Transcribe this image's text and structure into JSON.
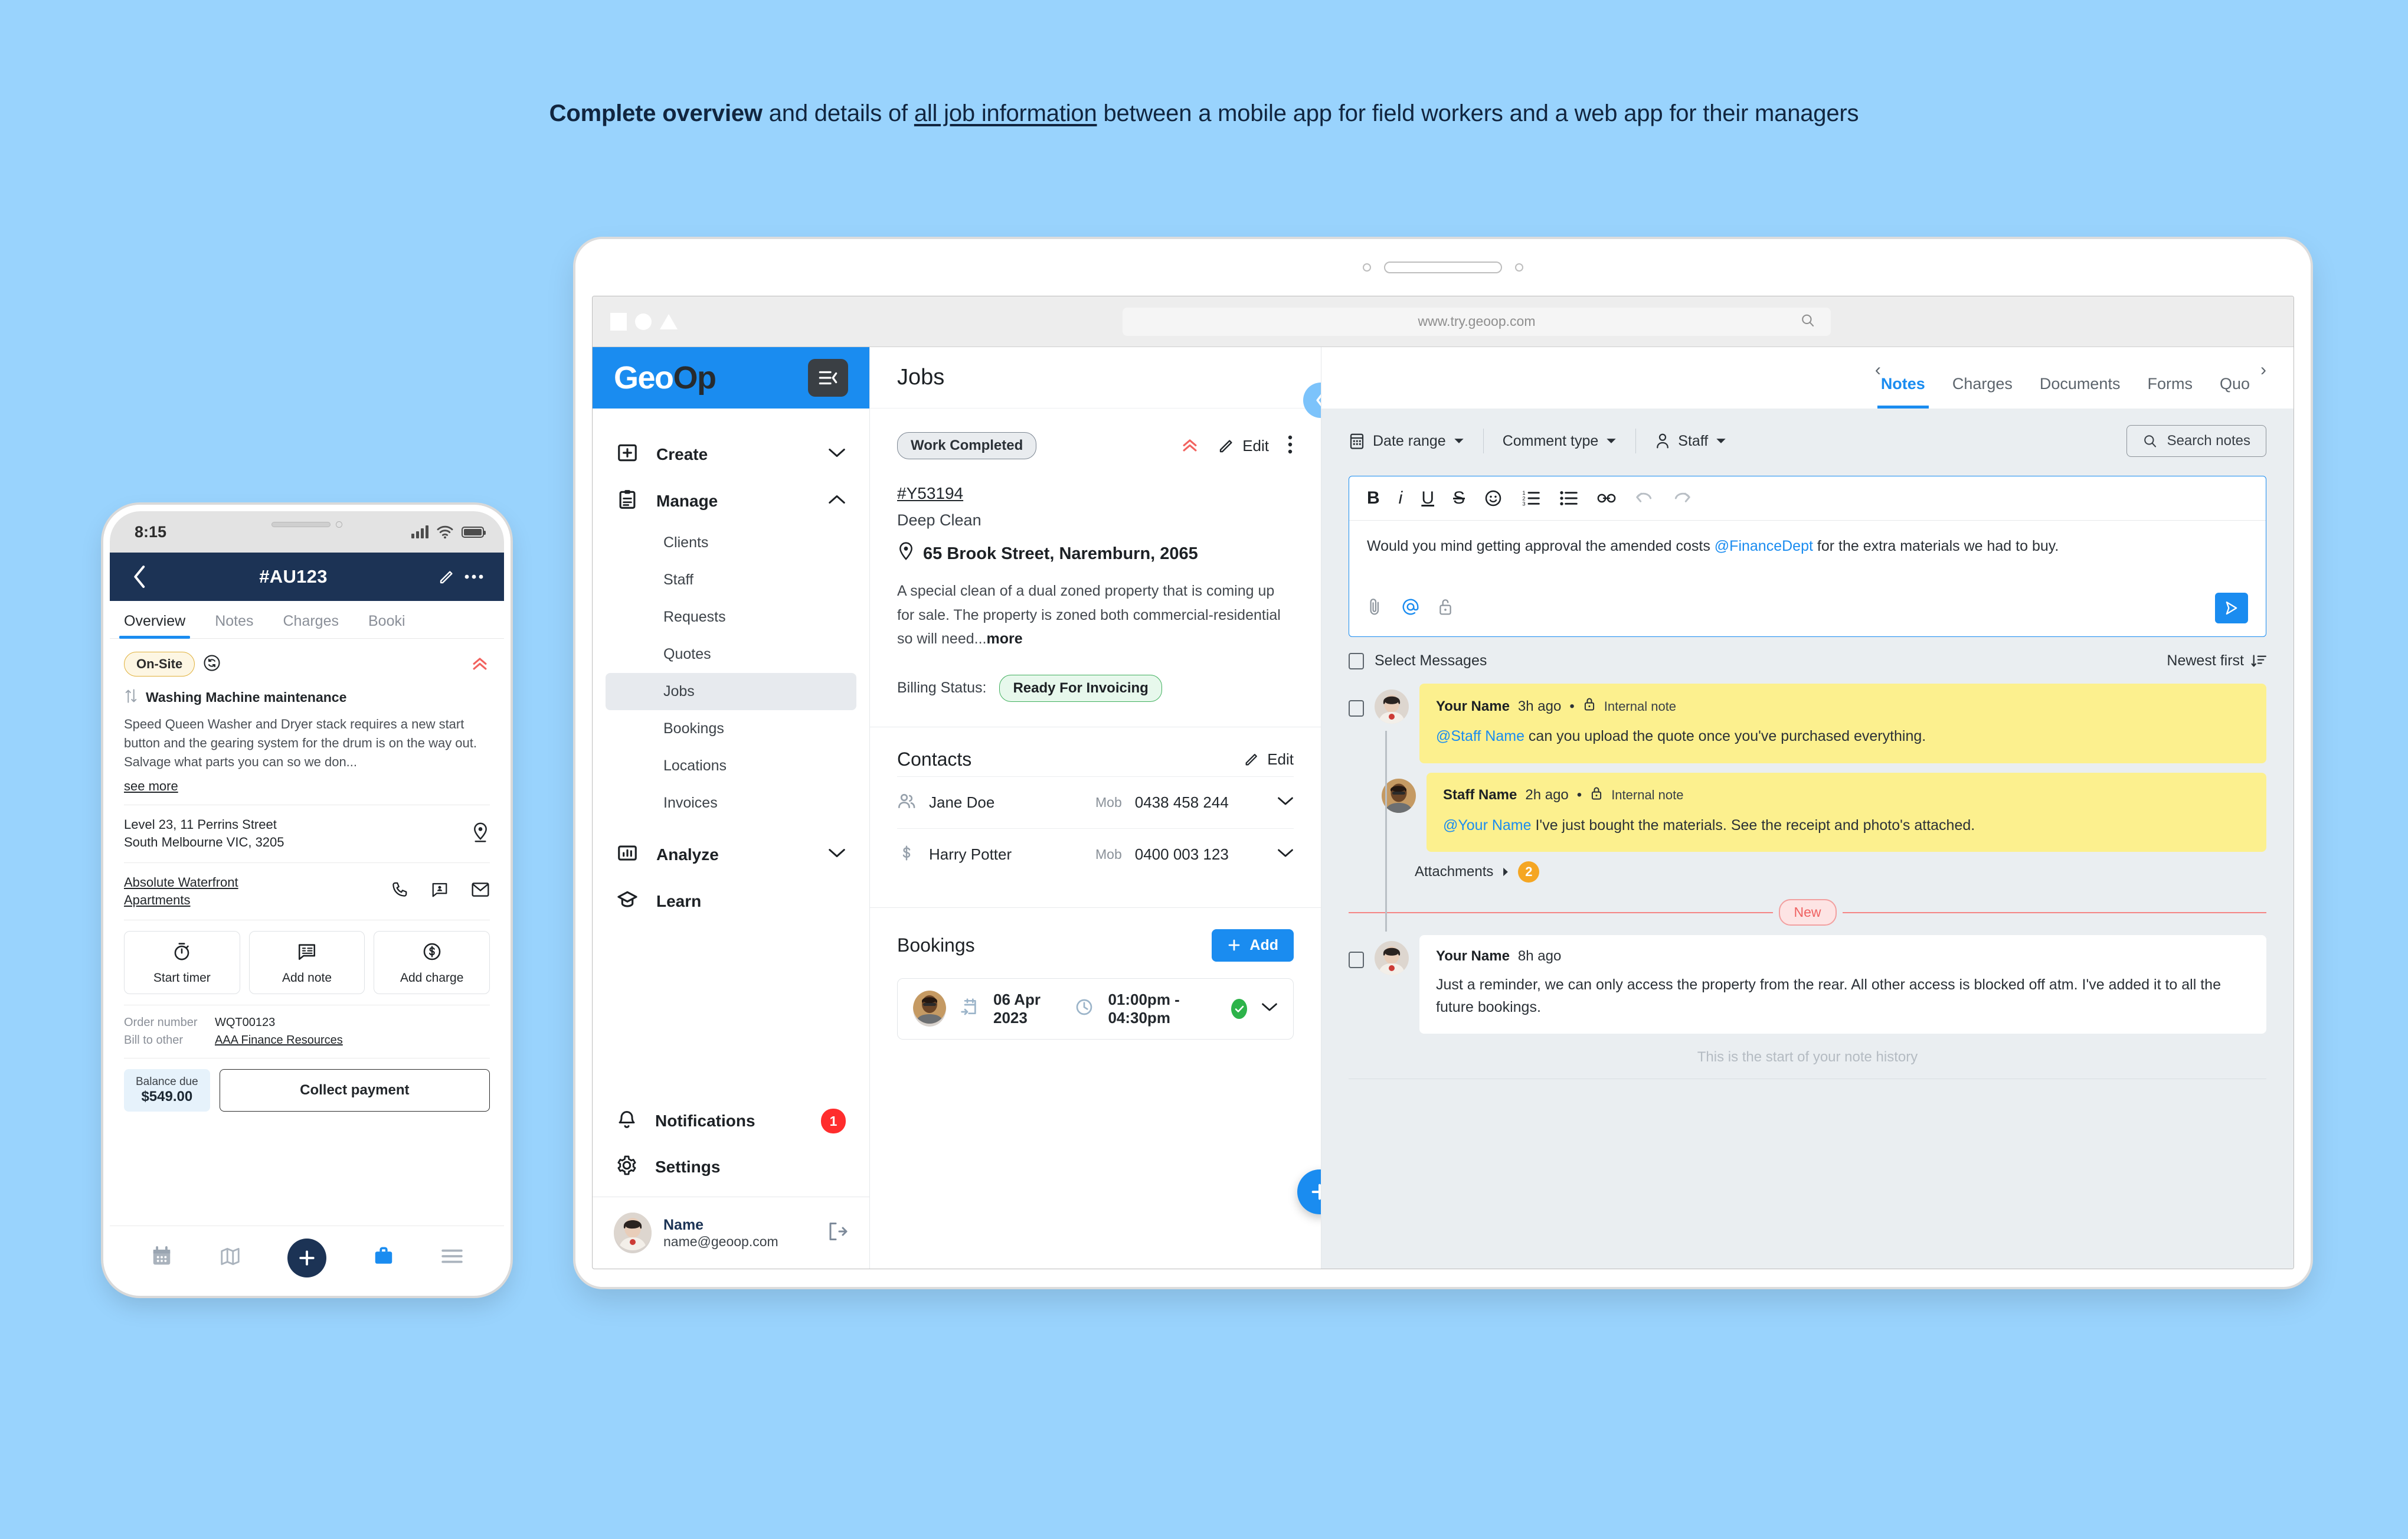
{
  "headline": {
    "bold": "Complete overview",
    "mid": " and details of ",
    "underlined": "all job information",
    "rest": " between a mobile app for field workers and a web app for their managers"
  },
  "phone": {
    "status": {
      "time": "8:15",
      "signal_icon": "cellular-signal-icon",
      "wifi_icon": "wifi-icon",
      "battery_icon": "battery-icon"
    },
    "appbar": {
      "back_icon": "back-chevron-icon",
      "title": "#AU123",
      "edit_icon": "pencil-icon",
      "more_icon": "more-horizontal-icon"
    },
    "tabs": [
      {
        "label": "Overview",
        "active": true
      },
      {
        "label": "Notes",
        "active": false
      },
      {
        "label": "Charges",
        "active": false
      },
      {
        "label": "Booki",
        "active": false
      }
    ],
    "status_chip": "On-Site",
    "sync_icon": "sync-icon",
    "priority_icon": "priority-high-icon",
    "job_title": "Washing Machine maintenance",
    "job_title_icon": "sort-updown-icon",
    "job_description": "Speed Queen Washer and Dryer stack requires a new start button and the gearing system for the drum is on the way out. Salvage what parts you can so we don...",
    "see_more": "see more",
    "address_line1": "Level 23, 11 Perrins Street",
    "address_line2": "South Melbourne VIC, 3205",
    "pin_icon": "map-pin-icon",
    "client_name": "Absolute Waterfront Apartments",
    "client_actions": [
      "phone-icon",
      "message-contact-icon",
      "email-icon"
    ],
    "quick_actions": [
      {
        "label": "Start timer",
        "icon": "stopwatch-icon"
      },
      {
        "label": "Add note",
        "icon": "note-bubble-icon"
      },
      {
        "label": "Add charge",
        "icon": "dollar-circle-icon"
      }
    ],
    "fields": [
      {
        "key": "Order number",
        "value": "WQT00123",
        "link": false
      },
      {
        "key": "Bill to other",
        "value": "AAA Finance Resources",
        "link": true
      }
    ],
    "balance_label": "Balance due",
    "balance_value": "$549.00",
    "collect_label": "Collect payment",
    "nav_icons": [
      "calendar-icon",
      "map-icon",
      "add-fab-icon",
      "briefcase-icon",
      "menu-icon"
    ]
  },
  "browser": {
    "url": "www.try.geoop.com",
    "search_icon": "search-icon"
  },
  "sidebar": {
    "logo_geo": "Geo",
    "logo_op": "Op",
    "collapse_icon": "sidebar-collapse-icon",
    "groups": [
      {
        "label": "Create",
        "icon": "plus-square-icon",
        "chevron": "chevron-down-icon"
      },
      {
        "label": "Manage",
        "icon": "clipboard-icon",
        "chevron": "chevron-up-icon"
      }
    ],
    "manage_items": [
      {
        "label": "Clients",
        "active": false
      },
      {
        "label": "Staff",
        "active": false
      },
      {
        "label": "Requests",
        "active": false
      },
      {
        "label": "Quotes",
        "active": false
      },
      {
        "label": "Jobs",
        "active": true
      },
      {
        "label": "Bookings",
        "active": false
      },
      {
        "label": "Locations",
        "active": false
      },
      {
        "label": "Invoices",
        "active": false
      }
    ],
    "lower_groups": [
      {
        "label": "Analyze",
        "icon": "bar-chart-icon",
        "chevron": "chevron-down-icon"
      },
      {
        "label": "Learn",
        "icon": "graduation-cap-icon",
        "chevron": ""
      }
    ],
    "bottom_items": [
      {
        "label": "Notifications",
        "icon": "bell-icon",
        "badge": "1"
      },
      {
        "label": "Settings",
        "icon": "gear-icon",
        "badge": ""
      }
    ],
    "user": {
      "name": "Name",
      "email": "name@geoop.com",
      "signout_icon": "sign-out-icon"
    }
  },
  "center": {
    "page_title": "Jobs",
    "status_chip": "Work Completed",
    "priority_icon": "priority-high-icon",
    "edit_label": "Edit",
    "edit_icon": "pencil-icon",
    "more_icon": "more-vertical-icon",
    "collapse_icon": "chevron-left-icon",
    "job_number": "#Y53194",
    "job_type": "Deep Clean",
    "job_address": "65 Brook Street, Naremburn, 2065",
    "address_icon": "map-pin-icon",
    "job_description": "A special clean of a dual zoned property that is coming up for sale. The property is zoned both commercial-residential so will need...",
    "more_link": "more",
    "billing_status_label": "Billing Status:",
    "billing_status_value": "Ready For Invoicing",
    "contacts_title": "Contacts",
    "contacts_edit": "Edit",
    "contacts": [
      {
        "icon": "people-icon",
        "name": "Jane Doe",
        "type": "Mob",
        "phone": "0438 458 244",
        "chevron": "chevron-down-icon"
      },
      {
        "icon": "dollar-icon",
        "name": "Harry Potter",
        "type": "Mob",
        "phone": "0400 003 123",
        "chevron": "chevron-down-icon"
      }
    ],
    "bookings_title": "Bookings",
    "bookings_add": "Add",
    "booking": {
      "date": "06 Apr 2023",
      "date_icon": "booking-calendar-icon",
      "time": "01:00pm - 04:30pm",
      "time_icon": "clock-icon",
      "status_icon": "check-circle-icon",
      "chevron": "chevron-down-icon"
    },
    "fab_icon": "add-fab-icon"
  },
  "right": {
    "nav_prev_icon": "chevron-left-icon",
    "nav_next_icon": "chevron-right-icon",
    "tabs": [
      {
        "label": "Notes",
        "active": true
      },
      {
        "label": "Charges",
        "active": false
      },
      {
        "label": "Documents",
        "active": false
      },
      {
        "label": "Forms",
        "active": false
      },
      {
        "label": "Quo",
        "active": false
      }
    ],
    "filters": [
      {
        "label": "Date range",
        "icon": "calendar-icon",
        "chevron": "caret-down-icon"
      },
      {
        "label": "Comment type",
        "icon": "",
        "chevron": "caret-down-icon"
      },
      {
        "label": "Staff",
        "icon": "person-icon",
        "chevron": "caret-down-icon"
      }
    ],
    "search_placeholder": "Search notes",
    "search_icon": "search-icon",
    "editor": {
      "toolbar": [
        "bold-icon",
        "italic-icon",
        "underline-icon",
        "strikethrough-icon",
        "emoji-icon",
        "ordered-list-icon",
        "bullet-list-icon",
        "link-icon",
        "undo-icon",
        "redo-icon"
      ],
      "text_before": "Would you mind getting approval the amended costs ",
      "mention": "@FinanceDept",
      "text_after": " for the extra materials we had to buy.",
      "footer_icons": [
        "attachment-icon",
        "mention-icon",
        "lock-open-icon"
      ],
      "send_icon": "send-icon"
    },
    "select_messages": "Select Messages",
    "sort_label": "Newest first",
    "sort_icon": "sort-descending-icon",
    "notes": [
      {
        "author": "Your Name",
        "time": "3h ago",
        "kind": "Internal note",
        "lock_icon": "lock-icon",
        "mention": "@Staff Name",
        "text": " can you upload the quote once you've purchased everything.",
        "style": "yellow",
        "indent": false
      },
      {
        "author": "Staff Name",
        "time": "2h ago",
        "kind": "Internal note",
        "lock_icon": "lock-icon",
        "mention": "@Your Name",
        "text": " I've just bought the materials. See the receipt and photo's attached.",
        "style": "yellow",
        "indent": true
      },
      {
        "author": "Your Name",
        "time": "8h ago",
        "kind": "",
        "lock_icon": "",
        "mention": "",
        "text": "Just a reminder, we can only access the property from the rear. All other access is blocked off atm. I've added it to all the future bookings.",
        "style": "plain",
        "indent": false
      }
    ],
    "attachments_label": "Attachments",
    "attachments_arrow": "caret-right-icon",
    "attachments_count": "2",
    "new_divider_label": "New",
    "history_end": "This is the start of your note history"
  },
  "colors": {
    "page_background": "#99d3fd",
    "brand_blue": "#1a8cf0",
    "phone_appbar": "#1c3355",
    "note_yellow": "#fcf08e",
    "badge_red": "#ff2d2d",
    "success_green": "#2db34a",
    "attachment_orange": "#f5a623",
    "new_red": "#ef6262"
  }
}
